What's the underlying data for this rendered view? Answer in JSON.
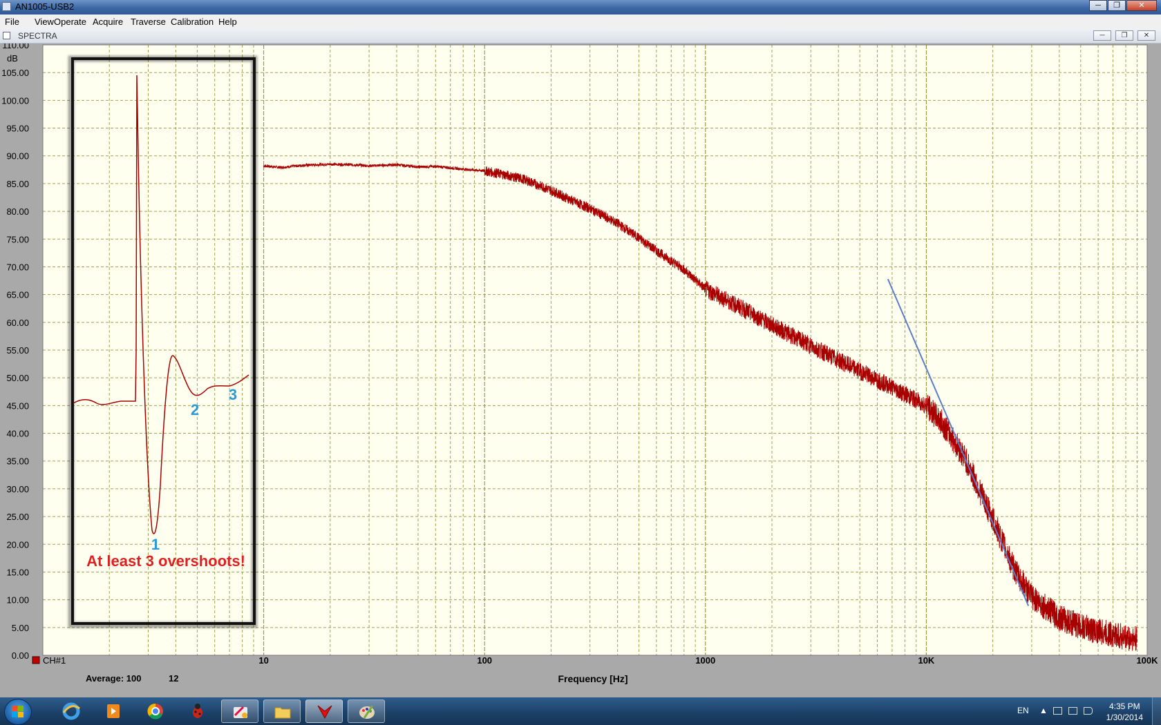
{
  "window": {
    "title": "AN1005-USB2",
    "buttons": [
      "─",
      "❐",
      "✕"
    ]
  },
  "menu": [
    {
      "label": "File"
    },
    {
      "label": "View"
    },
    {
      "label": "Operate"
    },
    {
      "label": "Acquire"
    },
    {
      "label": "Traverse"
    },
    {
      "label": "Calibration"
    },
    {
      "label": "Help"
    }
  ],
  "child_window": {
    "title": "SPECTRA",
    "buttons": [
      "─",
      "❐",
      "✕"
    ]
  },
  "chart_data": {
    "type": "line",
    "title": "",
    "xlabel": "Frequency [Hz]",
    "ylabel": "dB",
    "x_scale": "log",
    "xlim": [
      1,
      100000
    ],
    "ylim": [
      0,
      110
    ],
    "y_ticks": [
      "0.00",
      "5.00",
      "10.00",
      "15.00",
      "20.00",
      "25.00",
      "30.00",
      "35.00",
      "40.00",
      "45.00",
      "50.00",
      "55.00",
      "60.00",
      "65.00",
      "70.00",
      "75.00",
      "80.00",
      "85.00",
      "90.00",
      "95.00",
      "100.00",
      "105.00",
      "110.00"
    ],
    "x_ticks": [
      {
        "value": 10,
        "label": "10"
      },
      {
        "value": 100,
        "label": "100"
      },
      {
        "value": 1000,
        "label": "1000"
      },
      {
        "value": 10000,
        "label": "10K"
      },
      {
        "value": 100000,
        "label": "100K"
      }
    ],
    "grid": true,
    "grid_color": "#8a8a2e",
    "background": "#fffff0",
    "series": [
      {
        "name": "CH#1",
        "color": "#a80000",
        "x": [
          10,
          12,
          15,
          20,
          25,
          30,
          40,
          50,
          60,
          80,
          100,
          120,
          150,
          200,
          250,
          300,
          400,
          500,
          600,
          800,
          1000,
          1500,
          2000,
          3000,
          4000,
          5000,
          7000,
          10000,
          12000,
          15000,
          18000,
          20000,
          25000,
          30000,
          40000,
          50000,
          60000,
          70000,
          80000,
          90000
        ],
        "y": [
          88.2,
          87.9,
          88.3,
          88.5,
          88.4,
          88.2,
          88.4,
          88.0,
          88.1,
          87.6,
          87.3,
          86.7,
          85.8,
          83.8,
          81.9,
          80.5,
          77.8,
          75.2,
          72.9,
          69.5,
          66.0,
          62.3,
          59.5,
          55.8,
          53.2,
          51.2,
          48.3,
          45.0,
          41.5,
          35.5,
          28.5,
          24.5,
          15.5,
          10.5,
          6.8,
          5.2,
          4.3,
          3.7,
          3.2,
          2.8
        ]
      }
    ],
    "fit_line": {
      "color": "#5b7cc9",
      "x": [
        6700,
        29000
      ],
      "y": [
        67.8,
        8.9
      ]
    },
    "inset": {
      "label": "At least 3 overshoots!",
      "markers": [
        "1",
        "2",
        "3"
      ],
      "label_color": "#e02020",
      "marker_color": "#2a9ad6"
    }
  },
  "status": {
    "channel_label": "CH#1",
    "channel_color": "#c00000",
    "average_label": "Average: 100",
    "average_extra": "12"
  },
  "taskbar": {
    "items": [
      "start-button",
      "internet-explorer-icon",
      "media-player-icon",
      "chrome-icon",
      "bug-app-icon",
      "tools-app-icon",
      "file-explorer-icon",
      "analyzer-app-icon",
      "paint-icon"
    ],
    "active": "analyzer-app-icon",
    "language": "EN",
    "time": "4:35 PM",
    "date": "1/30/2014"
  }
}
